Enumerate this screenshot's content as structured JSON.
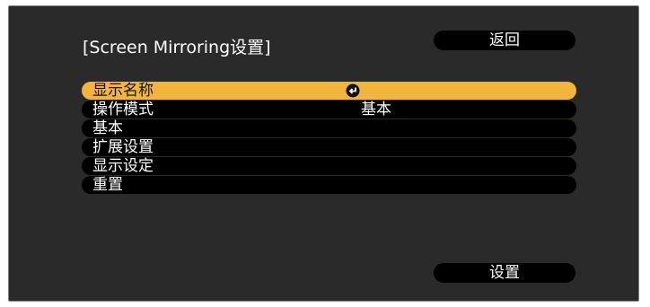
{
  "dialog": {
    "title": "[Screen Mirroring设置]",
    "back_label": "返回",
    "set_label": "设置"
  },
  "menu": {
    "items": [
      {
        "label": "显示名称",
        "icon": "enter-icon",
        "selected": true
      },
      {
        "label": "操作模式",
        "value": "基本"
      },
      {
        "label": "基本"
      },
      {
        "label": "扩展设置"
      },
      {
        "label": "显示设定"
      },
      {
        "label": "重置"
      }
    ]
  },
  "colors": {
    "background": "#2a2a2a",
    "button": "#000000",
    "highlight": "#f2b43a",
    "text": "#ffffff"
  }
}
